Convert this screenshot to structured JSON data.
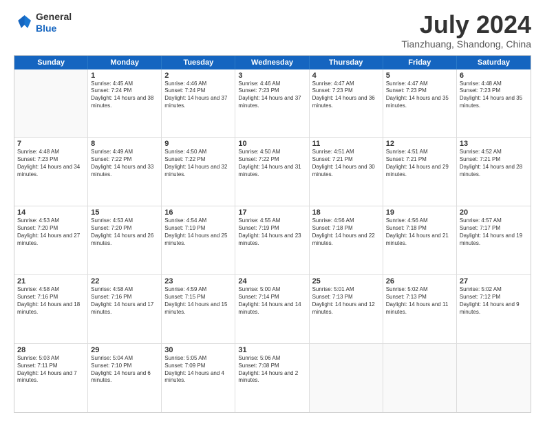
{
  "logo": {
    "general": "General",
    "blue": "Blue"
  },
  "title": "July 2024",
  "location": "Tianzhuang, Shandong, China",
  "weekdays": [
    "Sunday",
    "Monday",
    "Tuesday",
    "Wednesday",
    "Thursday",
    "Friday",
    "Saturday"
  ],
  "rows": [
    [
      {
        "day": "",
        "empty": true
      },
      {
        "day": "1",
        "sunrise": "4:45 AM",
        "sunset": "7:24 PM",
        "daylight": "14 hours and 38 minutes."
      },
      {
        "day": "2",
        "sunrise": "4:46 AM",
        "sunset": "7:24 PM",
        "daylight": "14 hours and 37 minutes."
      },
      {
        "day": "3",
        "sunrise": "4:46 AM",
        "sunset": "7:23 PM",
        "daylight": "14 hours and 37 minutes."
      },
      {
        "day": "4",
        "sunrise": "4:47 AM",
        "sunset": "7:23 PM",
        "daylight": "14 hours and 36 minutes."
      },
      {
        "day": "5",
        "sunrise": "4:47 AM",
        "sunset": "7:23 PM",
        "daylight": "14 hours and 35 minutes."
      },
      {
        "day": "6",
        "sunrise": "4:48 AM",
        "sunset": "7:23 PM",
        "daylight": "14 hours and 35 minutes."
      }
    ],
    [
      {
        "day": "7",
        "sunrise": "4:48 AM",
        "sunset": "7:23 PM",
        "daylight": "14 hours and 34 minutes."
      },
      {
        "day": "8",
        "sunrise": "4:49 AM",
        "sunset": "7:22 PM",
        "daylight": "14 hours and 33 minutes."
      },
      {
        "day": "9",
        "sunrise": "4:50 AM",
        "sunset": "7:22 PM",
        "daylight": "14 hours and 32 minutes."
      },
      {
        "day": "10",
        "sunrise": "4:50 AM",
        "sunset": "7:22 PM",
        "daylight": "14 hours and 31 minutes."
      },
      {
        "day": "11",
        "sunrise": "4:51 AM",
        "sunset": "7:21 PM",
        "daylight": "14 hours and 30 minutes."
      },
      {
        "day": "12",
        "sunrise": "4:51 AM",
        "sunset": "7:21 PM",
        "daylight": "14 hours and 29 minutes."
      },
      {
        "day": "13",
        "sunrise": "4:52 AM",
        "sunset": "7:21 PM",
        "daylight": "14 hours and 28 minutes."
      }
    ],
    [
      {
        "day": "14",
        "sunrise": "4:53 AM",
        "sunset": "7:20 PM",
        "daylight": "14 hours and 27 minutes."
      },
      {
        "day": "15",
        "sunrise": "4:53 AM",
        "sunset": "7:20 PM",
        "daylight": "14 hours and 26 minutes."
      },
      {
        "day": "16",
        "sunrise": "4:54 AM",
        "sunset": "7:19 PM",
        "daylight": "14 hours and 25 minutes."
      },
      {
        "day": "17",
        "sunrise": "4:55 AM",
        "sunset": "7:19 PM",
        "daylight": "14 hours and 23 minutes."
      },
      {
        "day": "18",
        "sunrise": "4:56 AM",
        "sunset": "7:18 PM",
        "daylight": "14 hours and 22 minutes."
      },
      {
        "day": "19",
        "sunrise": "4:56 AM",
        "sunset": "7:18 PM",
        "daylight": "14 hours and 21 minutes."
      },
      {
        "day": "20",
        "sunrise": "4:57 AM",
        "sunset": "7:17 PM",
        "daylight": "14 hours and 19 minutes."
      }
    ],
    [
      {
        "day": "21",
        "sunrise": "4:58 AM",
        "sunset": "7:16 PM",
        "daylight": "14 hours and 18 minutes."
      },
      {
        "day": "22",
        "sunrise": "4:58 AM",
        "sunset": "7:16 PM",
        "daylight": "14 hours and 17 minutes."
      },
      {
        "day": "23",
        "sunrise": "4:59 AM",
        "sunset": "7:15 PM",
        "daylight": "14 hours and 15 minutes."
      },
      {
        "day": "24",
        "sunrise": "5:00 AM",
        "sunset": "7:14 PM",
        "daylight": "14 hours and 14 minutes."
      },
      {
        "day": "25",
        "sunrise": "5:01 AM",
        "sunset": "7:13 PM",
        "daylight": "14 hours and 12 minutes."
      },
      {
        "day": "26",
        "sunrise": "5:02 AM",
        "sunset": "7:13 PM",
        "daylight": "14 hours and 11 minutes."
      },
      {
        "day": "27",
        "sunrise": "5:02 AM",
        "sunset": "7:12 PM",
        "daylight": "14 hours and 9 minutes."
      }
    ],
    [
      {
        "day": "28",
        "sunrise": "5:03 AM",
        "sunset": "7:11 PM",
        "daylight": "14 hours and 7 minutes."
      },
      {
        "day": "29",
        "sunrise": "5:04 AM",
        "sunset": "7:10 PM",
        "daylight": "14 hours and 6 minutes."
      },
      {
        "day": "30",
        "sunrise": "5:05 AM",
        "sunset": "7:09 PM",
        "daylight": "14 hours and 4 minutes."
      },
      {
        "day": "31",
        "sunrise": "5:06 AM",
        "sunset": "7:08 PM",
        "daylight": "14 hours and 2 minutes."
      },
      {
        "day": "",
        "empty": true
      },
      {
        "day": "",
        "empty": true
      },
      {
        "day": "",
        "empty": true
      }
    ]
  ]
}
